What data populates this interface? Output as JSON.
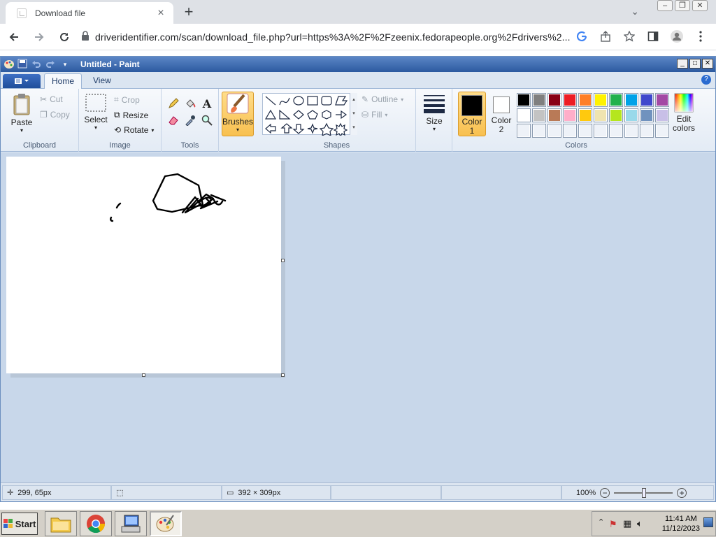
{
  "browser": {
    "tab_title": "Download file",
    "url": "driveridentifier.com/scan/download_file.php?url=https%3A%2F%2Fzeenix.fedorapeople.org%2Fdrivers%2..."
  },
  "paint": {
    "window_title": "Untitled - Paint",
    "tabs": [
      "Home",
      "View"
    ],
    "clipboard": {
      "paste": "Paste",
      "cut": "Cut",
      "copy": "Copy",
      "label": "Clipboard"
    },
    "image": {
      "select": "Select",
      "crop": "Crop",
      "resize": "Resize",
      "rotate": "Rotate",
      "label": "Image"
    },
    "tools_label": "Tools",
    "brushes": "Brushes",
    "shapes": {
      "outline": "Outline",
      "fill": "Fill",
      "label": "Shapes"
    },
    "size": "Size",
    "color1": "Color 1",
    "color2": "Color 2",
    "edit_colors": "Edit colors",
    "colors_label": "Colors",
    "palette": [
      "#000000",
      "#7f7f7f",
      "#880015",
      "#ed1c24",
      "#ff7f27",
      "#fff200",
      "#22b14c",
      "#00a2e8",
      "#3f48cc",
      "#a349a4",
      "#ffffff",
      "#c3c3c3",
      "#b97a57",
      "#ffaec9",
      "#ffc90e",
      "#efe4b0",
      "#b5e61d",
      "#99d9ea",
      "#7092be",
      "#c8bfe7",
      "#eef2f8",
      "#eef2f8",
      "#eef2f8",
      "#eef2f8",
      "#eef2f8",
      "#eef2f8",
      "#eef2f8",
      "#eef2f8",
      "#eef2f8",
      "#eef2f8"
    ],
    "status": {
      "cursor": "299, 65px",
      "canvas_size": "392 × 309px",
      "zoom": "100%"
    }
  },
  "taskbar": {
    "start": "Start",
    "time": "11:41 AM",
    "date": "11/12/2023"
  }
}
